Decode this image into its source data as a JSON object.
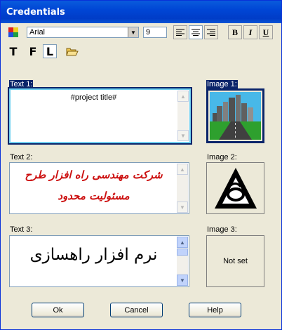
{
  "window": {
    "title": "Credentials"
  },
  "toolbar": {
    "font_name": "Arial",
    "font_size": "9",
    "align_left_icon": "align-left-icon",
    "align_center_icon": "align-center-icon",
    "align_right_icon": "align-right-icon",
    "bold_label": "B",
    "italic_label": "I",
    "underline_label": "U",
    "text_mode_label": "T",
    "field_mode_label": "F",
    "line_mode_label": "L"
  },
  "fields": {
    "text1": {
      "label": "Text 1:",
      "value": "#project title#"
    },
    "text2": {
      "label": "Text 2:",
      "line1": "شرکت مهندسی راه افزار طرح",
      "line2": "مسئولیت محدود"
    },
    "text3": {
      "label": "Text 3:",
      "value": "نرم افزار راهسازی"
    },
    "image1": {
      "label": "Image 1:"
    },
    "image2": {
      "label": "Image 2:"
    },
    "image3": {
      "label": "Image 3:",
      "value": "Not set"
    }
  },
  "buttons": {
    "ok": "Ok",
    "cancel": "Cancel",
    "help": "Help"
  },
  "colors": {
    "title_bar": "#0046d5",
    "selection": "#0a246a",
    "text2_color": "#cc1010"
  }
}
